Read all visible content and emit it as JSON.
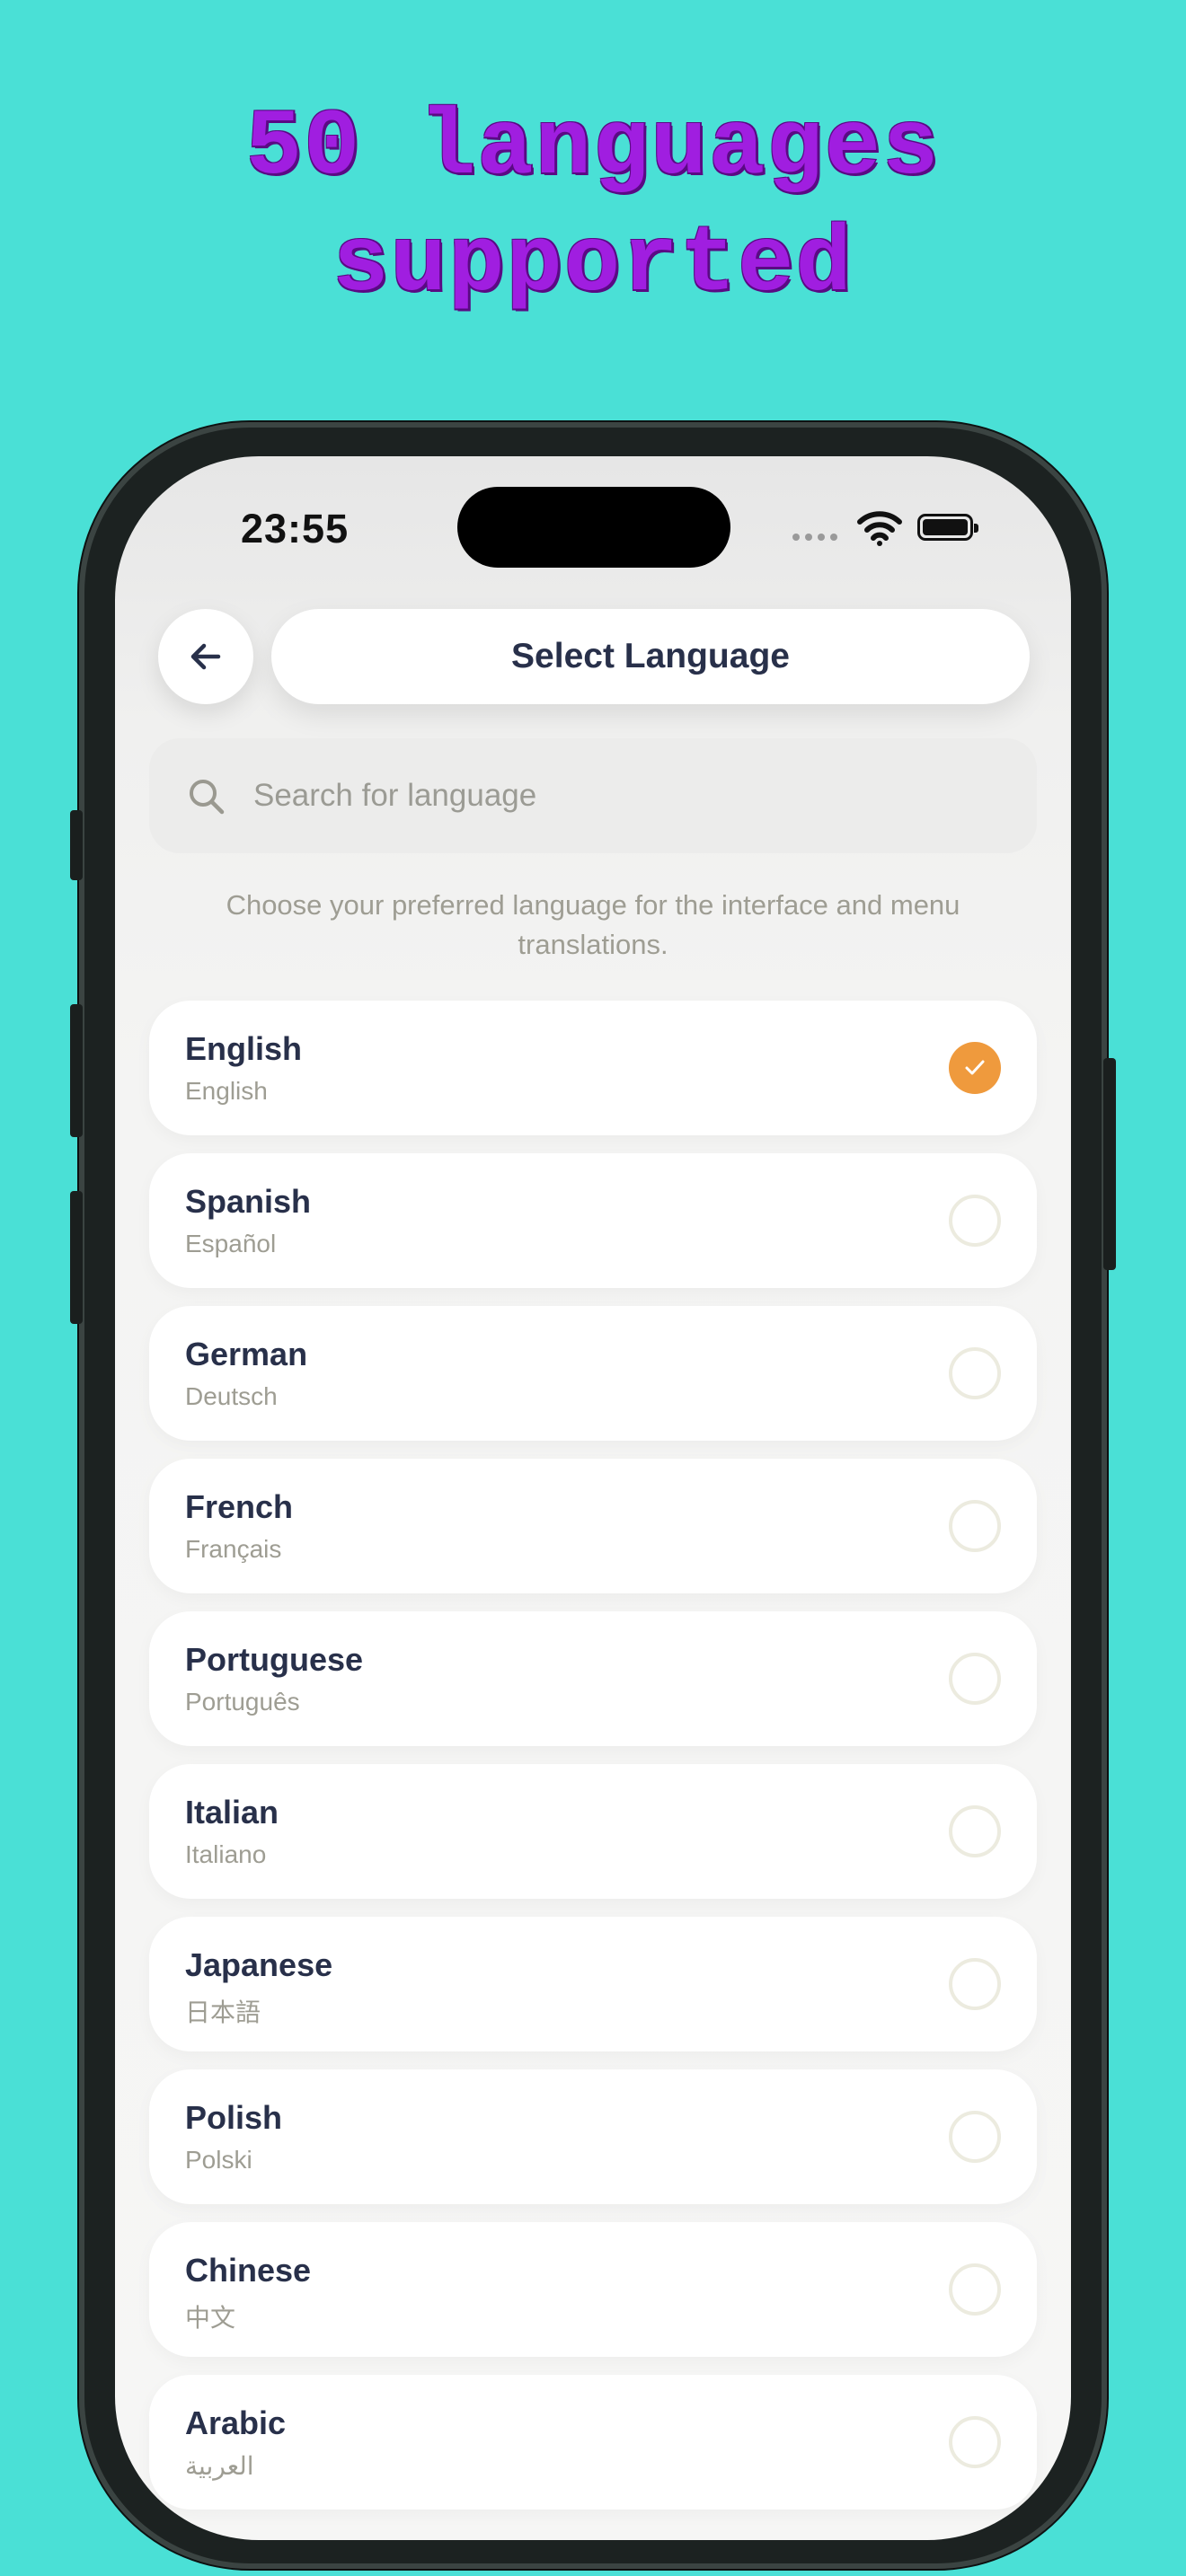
{
  "promo": {
    "headline_line1": "50 languages",
    "headline_line2": "supported"
  },
  "status_bar": {
    "time": "23:55"
  },
  "header": {
    "back_icon": "arrow-left-icon",
    "title": "Select Language"
  },
  "search": {
    "icon": "search-icon",
    "placeholder": "Search for language",
    "value": ""
  },
  "description": "Choose your preferred language for the interface and menu translations.",
  "languages": [
    {
      "name": "English",
      "native": "English",
      "selected": true
    },
    {
      "name": "Spanish",
      "native": "Español",
      "selected": false
    },
    {
      "name": "German",
      "native": "Deutsch",
      "selected": false
    },
    {
      "name": "French",
      "native": "Français",
      "selected": false
    },
    {
      "name": "Portuguese",
      "native": "Português",
      "selected": false
    },
    {
      "name": "Italian",
      "native": "Italiano",
      "selected": false
    },
    {
      "name": "Japanese",
      "native": "日本語",
      "selected": false
    },
    {
      "name": "Polish",
      "native": "Polski",
      "selected": false
    },
    {
      "name": "Chinese",
      "native": "中文",
      "selected": false
    },
    {
      "name": "Arabic",
      "native": "العربية",
      "selected": false
    }
  ],
  "colors": {
    "background": "#4ae0d6",
    "headline": "#a01ee0",
    "accent_selected": "#ef9a3d",
    "title_text": "#28304a",
    "muted_text": "#9e9d93"
  }
}
